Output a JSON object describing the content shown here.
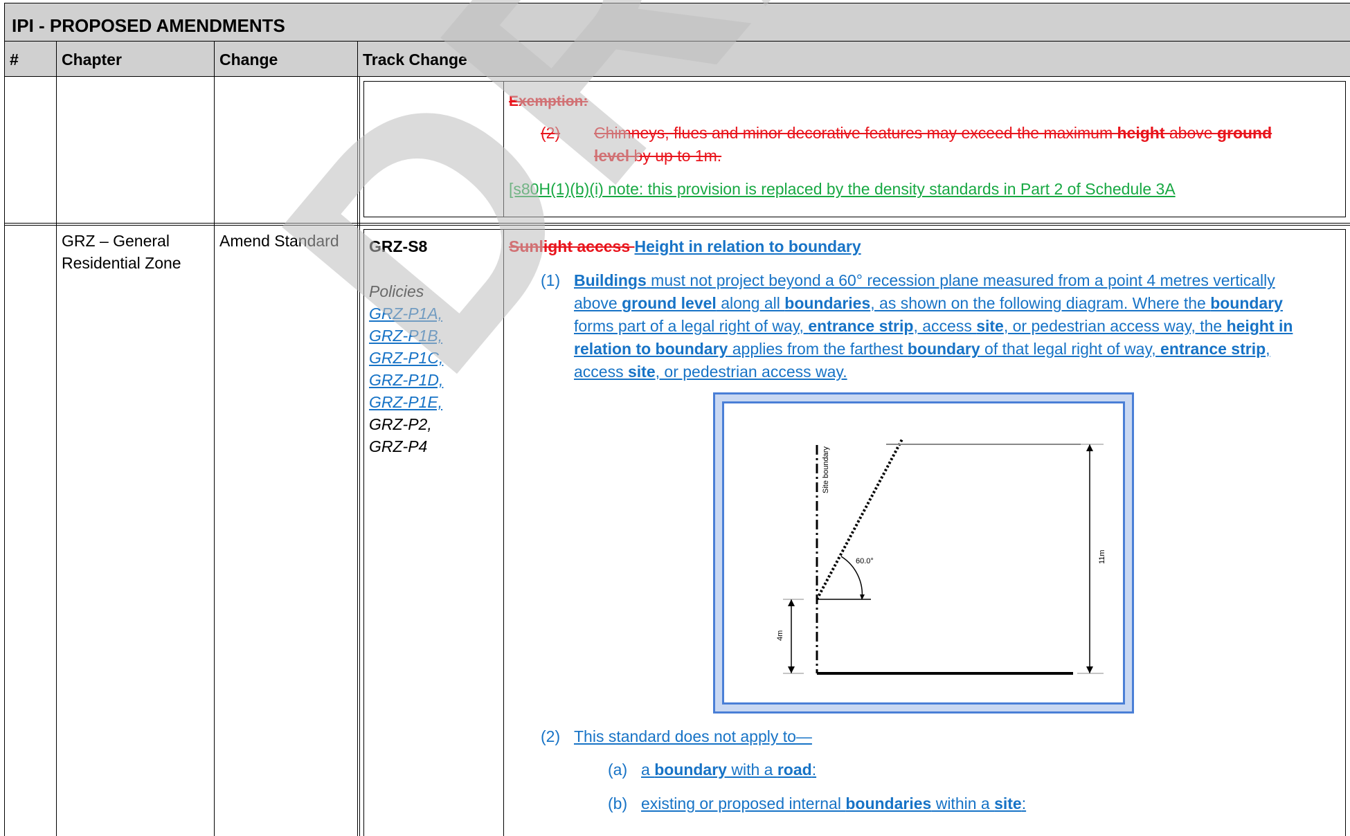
{
  "document": {
    "title": "IPI - PROPOSED AMENDMENTS",
    "columns": {
      "num": "#",
      "chapter": "Chapter",
      "change": "Change",
      "track_change": "Track Change"
    }
  },
  "row1": {
    "exemption_heading": "Exemption:",
    "item_number": "(2)",
    "item_text_1": "Chimneys, flues and minor decorative features may exceed the maximum ",
    "item_bold_height": "height",
    "item_text_2": " above ",
    "item_bold_ground": "ground",
    "item_bold_level": "level",
    "item_text_3": " by up to 1m.",
    "note": "[s80H(1)(b)(i) note: this provision is replaced by the density standards in Part 2 of Schedule 3A"
  },
  "row2": {
    "chapter_line1": "GRZ – General",
    "chapter_line2": "Residential Zone",
    "change": "Amend Standard",
    "standard_code": "GRZ-S8",
    "policies_label": "Policies",
    "policies_links": [
      "GRZ-P1A,",
      "GRZ-P1B,",
      "GRZ-P1C,",
      "GRZ-P1D,",
      "GRZ-P1E,"
    ],
    "policies_plain": [
      "GRZ-P2,",
      "GRZ-P4"
    ],
    "heading_deleted": "Sunlight access ",
    "heading_inserted": "Height in relation to boundary",
    "clause1_number": "(1)",
    "clause1": {
      "buildings": "Buildings",
      "t1": " must not project beyond a 60° recession plane measured from a point 4 metres vertically",
      "t2": "above ",
      "ground_level": "ground level",
      "t3": " along all ",
      "boundaries": "boundaries",
      "t4": ", as shown on the following diagram. Where the ",
      "boundary": "boundary",
      "t5": "forms part of a legal right of way, ",
      "entrance_strip": "entrance strip",
      "t6": ", access ",
      "site": "site",
      "t7": ", or pedestrian access way, the ",
      "height_in": "height in",
      "relation_to_boundary": "relation to boundary",
      "t8": " applies from the farthest ",
      "boundary2": "boundary",
      "t9": " of that legal right of way, ",
      "entrance_strip2": "entrance strip",
      "t10": ",",
      "t11": "access ",
      "site2": "site",
      "t12": ", or pedestrian access way."
    },
    "diagram": {
      "site_boundary_label": "Site boundary",
      "angle_label": "60.0°",
      "height_11m": "11m",
      "height_4m": "4m"
    },
    "clause2_number": "(2)",
    "clause2_text": "This standard does not apply to—",
    "sub_a_label": "(a)",
    "sub_a": {
      "t1": "a ",
      "boundary": "boundary",
      "t2": " with a ",
      "road": "road",
      "t3": ":"
    },
    "sub_b_label": "(b)",
    "sub_b": {
      "t1": "existing or proposed internal ",
      "boundaries": "boundaries",
      "t2": " within a ",
      "site": "site",
      "t3": ":"
    }
  },
  "watermark": "DRAFT",
  "colors": {
    "deleted": "#e8141c",
    "inserted_green": "#17a842",
    "inserted_blue": "#1773c6",
    "header_bg": "#d0d0d0",
    "watermark": "#bebebe"
  }
}
